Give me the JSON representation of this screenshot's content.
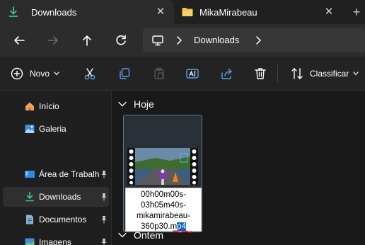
{
  "tabs": [
    {
      "label": "Downloads",
      "active": true
    },
    {
      "label": "MikaMirabeau",
      "active": false
    }
  ],
  "address": {
    "crumb": "Downloads"
  },
  "toolbar": {
    "new_label": "Novo",
    "sort_label": "Classificar"
  },
  "sidebar": {
    "items": [
      {
        "label": "Início",
        "icon": "home-icon",
        "pinned": false
      },
      {
        "label": "Galeria",
        "icon": "gallery-icon",
        "pinned": false
      },
      {
        "label": "Área de Trabalho",
        "icon": "desktop-icon",
        "pinned": true
      },
      {
        "label": "Downloads",
        "icon": "download-icon",
        "pinned": true,
        "selected": true
      },
      {
        "label": "Documentos",
        "icon": "documents-icon",
        "pinned": true
      },
      {
        "label": "Imagens",
        "icon": "pictures-icon",
        "pinned": true
      }
    ]
  },
  "groups": [
    {
      "label": "Hoje"
    },
    {
      "label": "Ontem"
    }
  ],
  "file": {
    "name_lines": [
      "00h00m00s-",
      "03h05m40s-",
      "mikamirabeau-"
    ],
    "name_last_prefix": "360p30.m",
    "name_last_selected": "p4"
  },
  "colors": {
    "accent": "#0a64c8",
    "download_green": "#36c3a0",
    "folder_yellow": "#f2c04a",
    "squiggle_red": "#e81123"
  }
}
